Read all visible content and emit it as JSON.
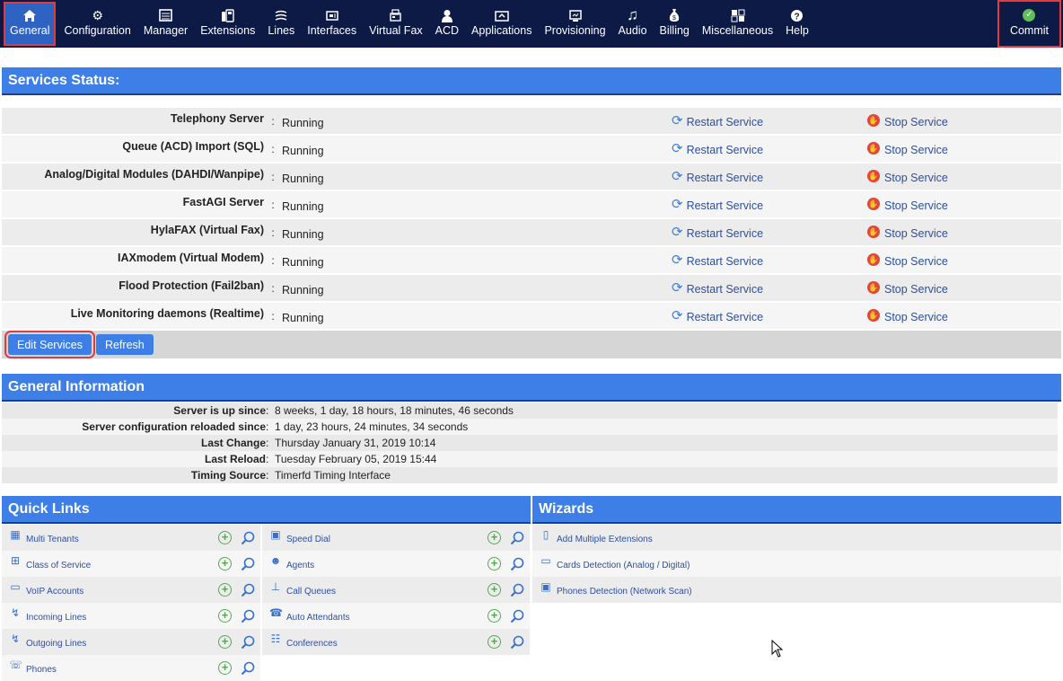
{
  "nav": {
    "items": [
      {
        "label": "General",
        "icon": "home-icon",
        "active": true
      },
      {
        "label": "Configuration",
        "icon": "gear-icon"
      },
      {
        "label": "Manager",
        "icon": "list-icon"
      },
      {
        "label": "Extensions",
        "icon": "phone-icon"
      },
      {
        "label": "Lines",
        "icon": "lines-icon"
      },
      {
        "label": "Interfaces",
        "icon": "interfaces-icon"
      },
      {
        "label": "Virtual Fax",
        "icon": "fax-icon"
      },
      {
        "label": "ACD",
        "icon": "user-icon"
      },
      {
        "label": "Applications",
        "icon": "applications-icon"
      },
      {
        "label": "Provisioning",
        "icon": "provisioning-icon"
      },
      {
        "label": "Audio",
        "icon": "music-note-icon"
      },
      {
        "label": "Billing",
        "icon": "money-bag-icon"
      },
      {
        "label": "Miscellaneous",
        "icon": "grid-icon"
      },
      {
        "label": "Help",
        "icon": "question-icon"
      }
    ],
    "commit_label": "Commit"
  },
  "services": {
    "title": "Services Status:",
    "restart_label": "Restart Service",
    "stop_label": "Stop Service",
    "rows": [
      {
        "name": "Telephony Server",
        "status": "Running"
      },
      {
        "name": "Queue (ACD) Import (SQL)",
        "status": "Running"
      },
      {
        "name": "Analog/Digital Modules (DAHDI/Wanpipe)",
        "status": "Running"
      },
      {
        "name": "FastAGI Server",
        "status": "Running"
      },
      {
        "name": "HylaFAX (Virtual Fax)",
        "status": "Running"
      },
      {
        "name": "IAXmodem (Virtual Modem)",
        "status": "Running"
      },
      {
        "name": "Flood Protection (Fail2ban)",
        "status": "Running"
      },
      {
        "name": "Live Monitoring daemons (Realtime)",
        "status": "Running"
      }
    ],
    "edit_label": "Edit Services",
    "refresh_label": "Refresh"
  },
  "general_info": {
    "title": "General Information",
    "rows": [
      {
        "label": "Server is up since",
        "value": "8 weeks, 1 day, 18 hours, 18 minutes, 46 seconds"
      },
      {
        "label": "Server configuration reloaded since",
        "value": "1 day, 23 hours, 24 minutes, 34 seconds"
      },
      {
        "label": "Last Change",
        "value": "Thursday January 31, 2019 10:14"
      },
      {
        "label": "Last Reload",
        "value": "Tuesday February 05, 2019 15:44"
      },
      {
        "label": "Timing Source",
        "value": "Timerfd Timing Interface"
      }
    ]
  },
  "quick_links": {
    "title": "Quick Links",
    "left": [
      {
        "label": "Multi Tenants",
        "icon": "building-icon"
      },
      {
        "label": "Class of Service",
        "icon": "hierarchy-icon"
      },
      {
        "label": "VoIP Accounts",
        "icon": "monitor-icon"
      },
      {
        "label": "Incoming Lines",
        "icon": "incoming-lines-icon"
      },
      {
        "label": "Outgoing Lines",
        "icon": "outgoing-lines-icon"
      },
      {
        "label": "Phones",
        "icon": "phone-icon"
      }
    ],
    "right": [
      {
        "label": "Speed Dial",
        "icon": "speed-dial-icon"
      },
      {
        "label": "Agents",
        "icon": "agent-icon"
      },
      {
        "label": "Call Queues",
        "icon": "queue-icon"
      },
      {
        "label": "Auto Attendants",
        "icon": "auto-attendant-icon"
      },
      {
        "label": "Conferences",
        "icon": "conference-icon"
      }
    ]
  },
  "wizards": {
    "title": "Wizards",
    "items": [
      {
        "label": "Add Multiple Extensions",
        "icon": "extensions-wizard-icon"
      },
      {
        "label": "Cards Detection (Analog / Digital)",
        "icon": "card-icon"
      },
      {
        "label": "Phones Detection (Network Scan)",
        "icon": "network-scan-icon"
      }
    ]
  },
  "colors": {
    "nav_bg": "#0c1a45",
    "accent": "#3d7fe6",
    "highlight": "#e23b3b",
    "link": "#2d4fa0"
  }
}
